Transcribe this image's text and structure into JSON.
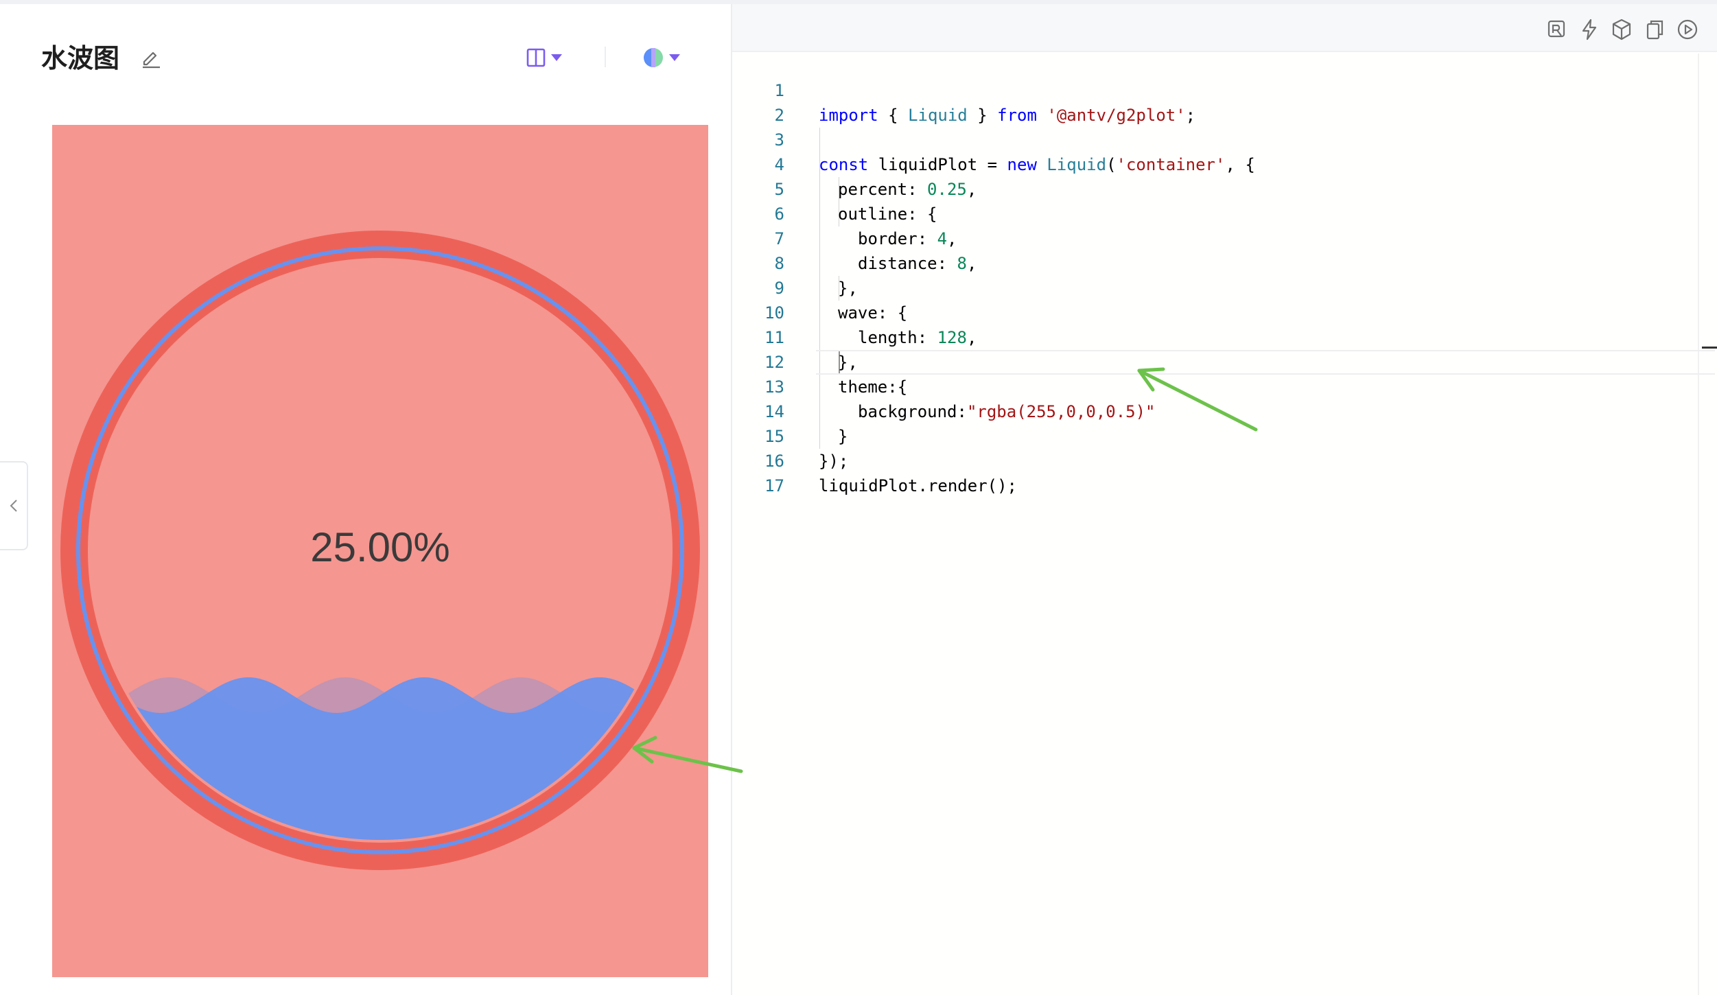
{
  "left_panel": {
    "title": "水波图",
    "icons": {
      "edit": "edit-pen-icon",
      "layout": "split-layout-icon",
      "theme": "theme-color-icon",
      "collapse": "chevron-left-icon"
    }
  },
  "chart_data": {
    "type": "liquid",
    "percent": 0.25,
    "label": "25.00%",
    "outline": {
      "border": 4,
      "distance": 8
    },
    "wave": {
      "length": 128
    },
    "colors": {
      "background": "#F59690",
      "outline": "#ED6258",
      "fill": "#6992EE",
      "text": "#3A3A3A"
    }
  },
  "editor": {
    "toolbar_icons": [
      "codesandbox-icon",
      "lightning-icon",
      "package-icon",
      "copy-icon",
      "play-icon"
    ],
    "lines": [
      {
        "n": "1"
      },
      {
        "n": "2"
      },
      {
        "n": "3"
      },
      {
        "n": "4"
      },
      {
        "n": "5"
      },
      {
        "n": "6"
      },
      {
        "n": "7"
      },
      {
        "n": "8"
      },
      {
        "n": "9"
      },
      {
        "n": "10"
      },
      {
        "n": "11"
      },
      {
        "n": "12"
      },
      {
        "n": "13"
      },
      {
        "n": "14"
      },
      {
        "n": "15"
      },
      {
        "n": "16"
      },
      {
        "n": "17"
      }
    ],
    "tokens": {
      "l1_import": "import",
      "l1_open": " { ",
      "l1_liquid": "Liquid",
      "l1_close": " } ",
      "l1_from": "from",
      "l1_sp": " ",
      "l1_pkg": "'@antv/g2plot'",
      "l1_end": ";",
      "l3_const": "const",
      "l3_var": " liquidPlot = ",
      "l3_new": "new",
      "l3_sp": " ",
      "l3_liquid": "Liquid",
      "l3_paren": "(",
      "l3_container": "'container'",
      "l3_end": ", {",
      "l4_key": "percent: ",
      "l4_val": "0.25",
      "l4_end": ",",
      "l5": "outline: {",
      "l6_key": "border: ",
      "l6_val": "4",
      "l6_end": ",",
      "l7_key": "distance: ",
      "l7_val": "8",
      "l7_end": ",",
      "l8": "},",
      "l9": "wave: {",
      "l10_key": "length: ",
      "l10_val": "128",
      "l10_end": ",",
      "l11": "},",
      "l12": "theme:{",
      "l13_key": "background:",
      "l13_val": "\"rgba(255,0,0,0.5)\"",
      "l14": "}",
      "l15": "});",
      "l16": "liquidPlot.render();"
    }
  },
  "annotation_color": "#6CC24A"
}
